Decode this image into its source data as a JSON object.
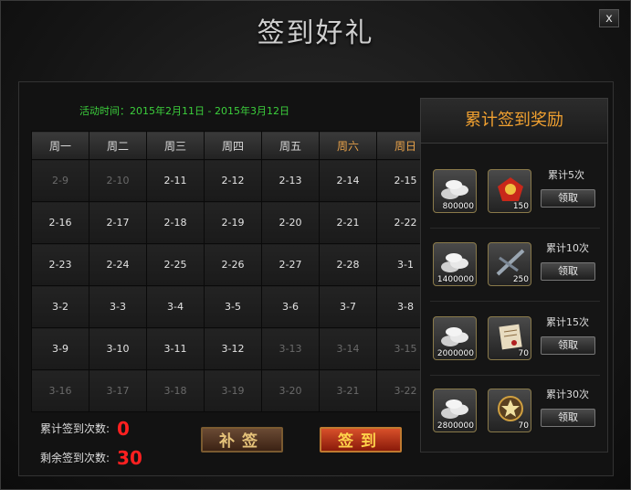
{
  "title": "签到好礼",
  "close_label": "x",
  "period": "活动时间：2015年2月11日 - 2015年3月12日",
  "calendar": {
    "headers": [
      "周一",
      "周二",
      "周三",
      "周四",
      "周五",
      "周六",
      "周日"
    ],
    "rows": [
      [
        "2-9",
        "2-10",
        "2-11",
        "2-12",
        "2-13",
        "2-14",
        "2-15"
      ],
      [
        "2-16",
        "2-17",
        "2-18",
        "2-19",
        "2-20",
        "2-21",
        "2-22"
      ],
      [
        "2-23",
        "2-24",
        "2-25",
        "2-26",
        "2-27",
        "2-28",
        "3-1"
      ],
      [
        "3-2",
        "3-3",
        "3-4",
        "3-5",
        "3-6",
        "3-7",
        "3-8"
      ],
      [
        "3-9",
        "3-10",
        "3-11",
        "3-12",
        "3-13",
        "3-14",
        "3-15"
      ],
      [
        "3-16",
        "3-17",
        "3-18",
        "3-19",
        "3-20",
        "3-21",
        "3-22"
      ]
    ]
  },
  "stats": {
    "total_label": "累计签到次数:",
    "total_value": "0",
    "remain_label": "剩余签到次数:",
    "remain_value": "30"
  },
  "buttons": {
    "makeup": "补签",
    "signin": "签到"
  },
  "rewards": {
    "title": "累计签到奖励",
    "claim_label": "领取",
    "tiers": [
      {
        "label": "累计5次",
        "silver": "800000",
        "item_count": "150",
        "item_icon": "medal-icon"
      },
      {
        "label": "累计10次",
        "silver": "1400000",
        "item_count": "250",
        "item_icon": "rifle-icon"
      },
      {
        "label": "累计15次",
        "silver": "2000000",
        "item_count": "70",
        "item_icon": "scroll-icon"
      },
      {
        "label": "累计30次",
        "silver": "2800000",
        "item_count": "70",
        "item_icon": "star-emblem-icon"
      }
    ]
  },
  "colors": {
    "accent": "#f0a030",
    "green": "#3ccf3c",
    "red": "#ff2020",
    "weekend": "#e8a24a"
  }
}
